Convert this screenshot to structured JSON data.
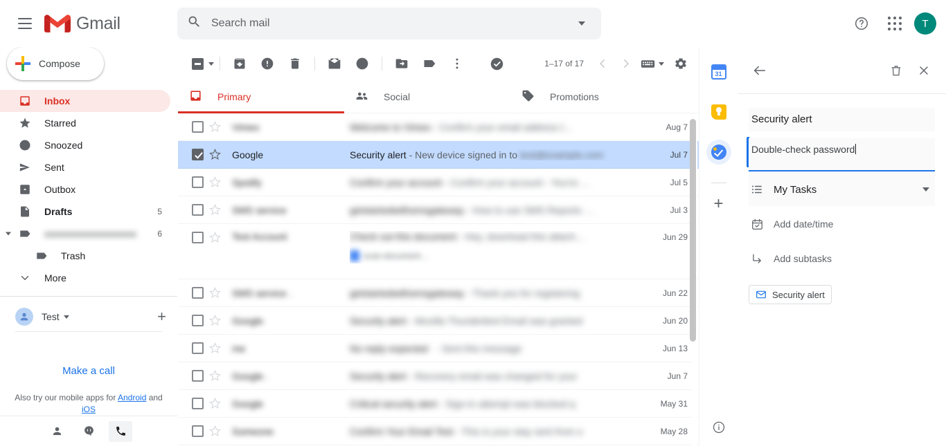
{
  "header": {
    "menu_icon": "hamburger-icon",
    "brand": "Gmail",
    "search_placeholder": "Search mail",
    "search_value": "",
    "help_icon": "help-icon",
    "apps_icon": "apps-grid-icon",
    "avatar_initial": "T"
  },
  "sidebar": {
    "compose_label": "Compose",
    "items": [
      {
        "label": "Inbox",
        "icon": "inbox-icon",
        "count": "",
        "active": true,
        "bold": true
      },
      {
        "label": "Starred",
        "icon": "star-icon",
        "count": "",
        "active": false,
        "bold": false
      },
      {
        "label": "Snoozed",
        "icon": "clock-icon",
        "count": "",
        "active": false,
        "bold": false
      },
      {
        "label": "Sent",
        "icon": "send-icon",
        "count": "",
        "active": false,
        "bold": false
      },
      {
        "label": "Outbox",
        "icon": "outbox-icon",
        "count": "",
        "active": false,
        "bold": false
      },
      {
        "label": "Drafts",
        "icon": "draft-icon",
        "count": "5",
        "active": false,
        "bold": true
      },
      {
        "label": "",
        "icon": "label-icon",
        "count": "6",
        "active": false,
        "bold": false,
        "blurred": true
      },
      {
        "label": "Trash",
        "icon": "label-icon",
        "count": "",
        "active": false,
        "bold": false,
        "nested": true
      },
      {
        "label": "More",
        "icon": "chevron-down-icon",
        "count": "",
        "active": false,
        "bold": false
      }
    ],
    "hangouts": {
      "user_name": "Test",
      "add_icon": "plus-icon",
      "make_call": "Make a call",
      "note_prefix": "Also try our mobile apps for ",
      "note_android": "Android",
      "note_and": " and ",
      "note_ios": "iOS",
      "tabs": [
        "contacts-icon",
        "conversations-icon",
        "phone-icon"
      ]
    }
  },
  "toolbar": {
    "select_all_icon": "checkbox-partial-icon",
    "buttons": [
      "archive-icon",
      "report-spam-icon",
      "delete-icon",
      "mark-unread-icon",
      "snooze-icon",
      "move-to-icon",
      "labels-icon",
      "more-options-icon",
      "tasks-icon"
    ],
    "page_range": "1–17 of 17",
    "prev_icon": "chevron-left-icon",
    "next_icon": "chevron-right-icon",
    "input-tools_icon": "keyboard-icon",
    "settings_icon": "gear-icon"
  },
  "tabs": [
    {
      "label": "Primary",
      "icon": "inbox-icon",
      "active": true
    },
    {
      "label": "Social",
      "icon": "people-icon",
      "active": false
    },
    {
      "label": "Promotions",
      "icon": "tag-icon",
      "active": false
    }
  ],
  "mail_rows": [
    {
      "sender": "",
      "subject": "",
      "snippet": "",
      "date": "Aug 7",
      "blurred": true,
      "selected": false
    },
    {
      "sender": "Google",
      "subject": "Security alert",
      "snippet": " - New device signed in to",
      "date": "Jul 7",
      "blurred": false,
      "selected": true,
      "snippet_blur_tail": true
    },
    {
      "sender": "",
      "subject": "",
      "snippet": "",
      "date": "Jul 5",
      "blurred": true,
      "selected": false
    },
    {
      "sender": "",
      "subject": "",
      "snippet": "",
      "date": "Jul 3",
      "blurred": true,
      "selected": false
    },
    {
      "sender": "",
      "subject": "",
      "snippet": "",
      "date": "Jun 29",
      "blurred": true,
      "selected": false,
      "attachment": true
    },
    {
      "sender": "",
      "subject": "",
      "snippet": "",
      "date": "Jun 22",
      "blurred": true,
      "selected": false
    },
    {
      "sender": "",
      "subject": "",
      "snippet": "",
      "date": "Jun 20",
      "blurred": true,
      "selected": false
    },
    {
      "sender": "",
      "subject": "",
      "snippet": "",
      "date": "Jun 13",
      "blurred": true,
      "selected": false
    },
    {
      "sender": "",
      "subject": "",
      "snippet": "",
      "date": "Jun 7",
      "blurred": true,
      "selected": false
    },
    {
      "sender": "",
      "subject": "",
      "snippet": "",
      "date": "May 31",
      "blurred": true,
      "selected": false
    },
    {
      "sender": "",
      "subject": "",
      "snippet": "",
      "date": "May 28",
      "blurred": true,
      "selected": false
    }
  ],
  "rail": {
    "apps": [
      {
        "name": "calendar-icon",
        "label": "31",
        "active": false
      },
      {
        "name": "keep-icon",
        "label": "",
        "active": false
      },
      {
        "name": "tasks-icon",
        "label": "",
        "active": true
      }
    ],
    "add_icon": "plus-icon",
    "info_icon": "info-icon"
  },
  "tasks_panel": {
    "back_icon": "back-arrow-icon",
    "delete_icon": "trash-icon",
    "close_icon": "close-icon",
    "task_title": "Security alert",
    "task_details": "Double-check password",
    "list_name": "My Tasks",
    "list_icon": "list-icon",
    "date_label": "Add date/time",
    "date_icon": "calendar-icon",
    "subtasks_label": "Add subtasks",
    "subtasks_icon": "subtask-arrow-icon",
    "linked_mail": "Security alert",
    "linked_mail_icon": "envelope-icon"
  },
  "colors": {
    "gmail_red": "#d93025",
    "selected_row": "#c2dbff",
    "accent_blue": "#1a73e8",
    "avatar_teal": "#00897b"
  }
}
